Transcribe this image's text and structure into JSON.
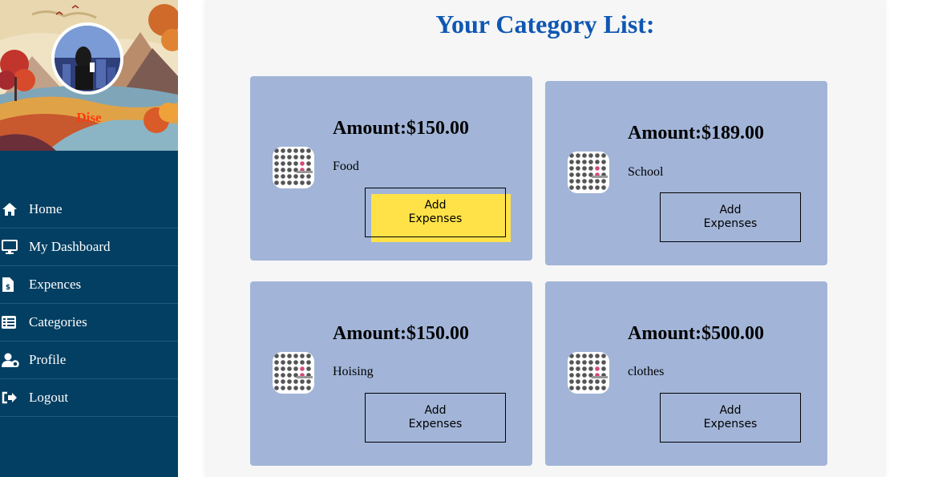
{
  "sidebar": {
    "username": "Dise",
    "nav": [
      {
        "label": "Home",
        "icon": "home-icon"
      },
      {
        "label": "My Dashboard",
        "icon": "monitor-icon"
      },
      {
        "label": "Expences",
        "icon": "invoice-icon"
      },
      {
        "label": "Categories",
        "icon": "list-icon"
      },
      {
        "label": "Profile",
        "icon": "user-gear-icon"
      },
      {
        "label": "Logout",
        "icon": "logout-icon"
      }
    ]
  },
  "main": {
    "title": "Your Category List:",
    "cards": [
      {
        "amount": "Amount:$150.00",
        "name": "Food",
        "button": "Add\nExpenses",
        "highlighted": true
      },
      {
        "amount": "Amount:$189.00",
        "name": "School",
        "button": "Add\nExpenses",
        "highlighted": false
      },
      {
        "amount": "Amount:$150.00",
        "name": "Hoising",
        "button": "Add\nExpenses",
        "highlighted": false
      },
      {
        "amount": "Amount:$500.00",
        "name": "clothes",
        "button": "Add\nExpenses",
        "highlighted": false
      }
    ]
  },
  "colors": {
    "sidebar_bg": "#033f62",
    "card_bg": "#a2b5d8",
    "title": "#0f57b3",
    "highlight": "#fee248",
    "username": "#ff3a10"
  }
}
